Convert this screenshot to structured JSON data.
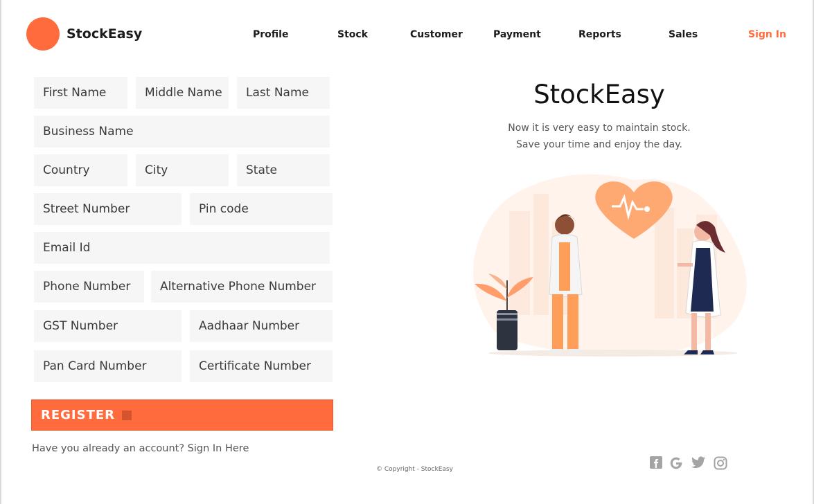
{
  "header": {
    "brand": "StockEasy",
    "nav": [
      "Profile",
      "Stock",
      "Customer",
      "Payment",
      "Reports",
      "Sales"
    ],
    "signin": "Sign In"
  },
  "form": {
    "first_name": "First Name",
    "middle_name": "Middle Name",
    "last_name": "Last Name",
    "business_name": "Business Name",
    "country": "Country",
    "city": "City",
    "state": "State",
    "street_number": "Street Number",
    "pin_code": "Pin code",
    "email": "Email Id",
    "phone": "Phone Number",
    "alt_phone": "Alternative Phone Number",
    "gst": "GST Number",
    "aadhaar": "Aadhaar Number",
    "pan": "Pan Card Number",
    "certificate": "Certificate Number",
    "register": "REGISTER",
    "already": "Have you already an account? Sign In Here"
  },
  "hero": {
    "title": "StockEasy",
    "line1": "Now it is very easy to maintain stock.",
    "line2": "Save your time and enjoy the day."
  },
  "footer": {
    "copyright": "© Copyright - StockEasy",
    "social": [
      "facebook-icon",
      "google-icon",
      "twitter-icon",
      "instagram-icon"
    ]
  },
  "colors": {
    "accent": "#ff6b3d",
    "field_bg": "#f6f6f6"
  }
}
